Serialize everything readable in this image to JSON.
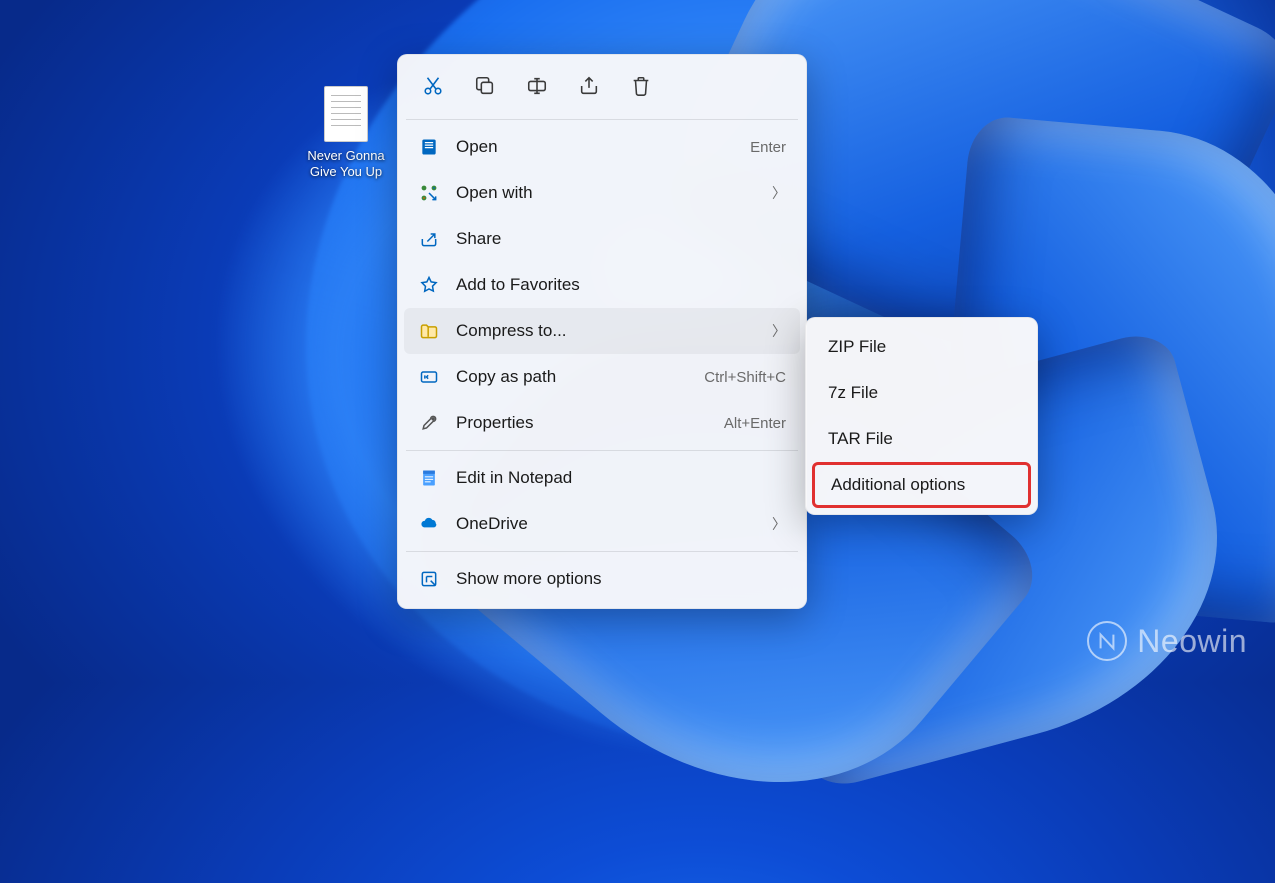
{
  "desktop": {
    "file_label": "Never Gonna Give You Up"
  },
  "context_menu": {
    "actions": [
      {
        "name": "cut"
      },
      {
        "name": "copy"
      },
      {
        "name": "rename"
      },
      {
        "name": "share"
      },
      {
        "name": "delete"
      }
    ],
    "items": [
      {
        "icon": "open-icon",
        "label": "Open",
        "shortcut": "Enter"
      },
      {
        "icon": "open-with-icon",
        "label": "Open with",
        "submenu": true
      },
      {
        "icon": "share-icon",
        "label": "Share"
      },
      {
        "icon": "star-icon",
        "label": "Add to Favorites"
      },
      {
        "icon": "compress-icon",
        "label": "Compress to...",
        "submenu": true,
        "hovered": true
      },
      {
        "icon": "copy-path-icon",
        "label": "Copy as path",
        "shortcut": "Ctrl+Shift+C"
      },
      {
        "icon": "properties-icon",
        "label": "Properties",
        "shortcut": "Alt+Enter"
      }
    ],
    "items_group2": [
      {
        "icon": "notepad-icon",
        "label": "Edit in Notepad"
      },
      {
        "icon": "onedrive-icon",
        "label": "OneDrive",
        "submenu": true
      }
    ],
    "items_group3": [
      {
        "icon": "more-icon",
        "label": "Show more options"
      }
    ]
  },
  "submenu": {
    "items": [
      {
        "label": "ZIP File"
      },
      {
        "label": "7z File"
      },
      {
        "label": "TAR File"
      },
      {
        "label": "Additional options",
        "highlighted": true
      }
    ]
  },
  "watermark": {
    "text": "Neowin"
  }
}
